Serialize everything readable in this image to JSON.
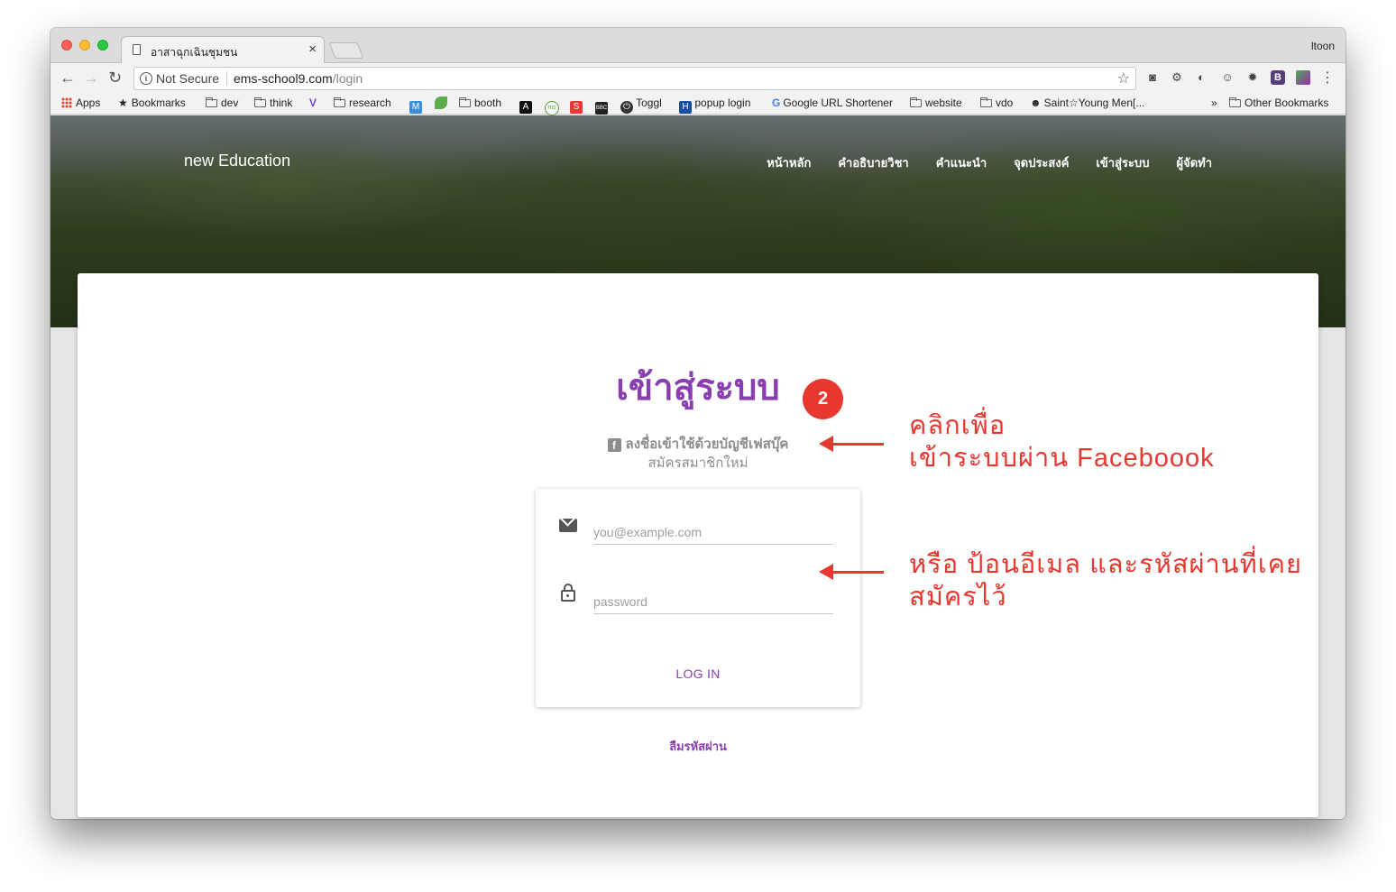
{
  "browser": {
    "tab_title": "อาสาฉุกเฉินชุมชน",
    "tab_close": "×",
    "profile": "ltoon",
    "security_label": "Not Secure",
    "url_host": "ems-school9.com",
    "url_path": "/login"
  },
  "bookmarks": [
    {
      "label": "Apps",
      "icon": "apps-grid-icon"
    },
    {
      "label": "Bookmarks",
      "icon": "star-icon"
    },
    {
      "label": "dev",
      "icon": "folder-icon"
    },
    {
      "label": "think",
      "icon": "folder-icon"
    },
    {
      "label": "research",
      "icon": "folder-icon"
    },
    {
      "label": "booth",
      "icon": "folder-icon"
    },
    {
      "label": "Toggl",
      "icon": "toggl-icon"
    },
    {
      "label": "popup login",
      "icon": "h-icon"
    },
    {
      "label": "Google URL Shortener",
      "icon": "google-icon"
    },
    {
      "label": "website",
      "icon": "folder-icon"
    },
    {
      "label": "vdo",
      "icon": "folder-icon"
    },
    {
      "label": "Saint☆Young Men[...",
      "icon": "anime-icon"
    },
    {
      "label": "»",
      "icon": "overflow-icon"
    },
    {
      "label": "Other Bookmarks",
      "icon": "folder-icon"
    }
  ],
  "site": {
    "brand": "new Education",
    "nav": [
      "หน้าหลัก",
      "คำอธิบายวิชา",
      "คำแนะนำ",
      "จุดประสงค์",
      "เข้าสู่ระบบ",
      "ผู้จัดทำ"
    ]
  },
  "login": {
    "title": "เข้าสู่ระบบ",
    "facebook_icon": "f",
    "facebook_label": "ลงชื่อเข้าใช้ด้วยบัญชีเฟสบุ๊ค",
    "signup_label": "สมัครสมาชิกใหม่",
    "email_placeholder": "you@example.com",
    "password_placeholder": "password",
    "login_button": "LOG IN",
    "forgot_password": "ลืมรหัสผ่าน"
  },
  "annotations": {
    "step_badge": "2",
    "note_facebook_line1": "คลิกเพื่อ",
    "note_facebook_line2": "เข้าระบบผ่าน Faceboook",
    "note_email_line1": "หรือ ป้อนอีเมล และรหัสผ่านที่เคย",
    "note_email_line2": "สมัครไว้"
  },
  "colors": {
    "accent": "#8a3fb0",
    "annotation": "#e8372f",
    "muted_text": "#8c8c8c"
  }
}
